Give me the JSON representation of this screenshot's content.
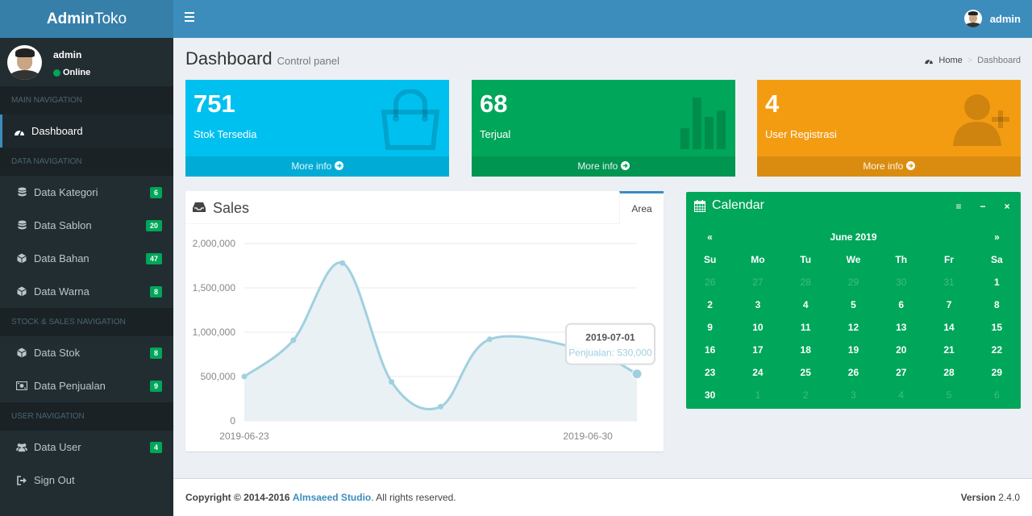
{
  "header": {
    "logo_bold": "Admin",
    "logo_rest": "Toko",
    "user_name": "admin"
  },
  "sidebar": {
    "user_name": "admin",
    "user_status": "Online",
    "sections": [
      {
        "header": "MAIN NAVIGATION"
      },
      {
        "header": "DATA NAVIGATION"
      },
      {
        "header": "STOCK & SALES NAVIGATION"
      },
      {
        "header": "USER NAVIGATION"
      }
    ],
    "items": [
      {
        "label": "Dashboard",
        "icon": "dashboard-icon"
      },
      {
        "label": "Data Kategori",
        "icon": "database-icon",
        "badge": "6"
      },
      {
        "label": "Data Sablon",
        "icon": "database-icon",
        "badge": "20"
      },
      {
        "label": "Data Bahan",
        "icon": "cube-icon",
        "badge": "47"
      },
      {
        "label": "Data Warna",
        "icon": "cube-icon",
        "badge": "8"
      },
      {
        "label": "Data Stok",
        "icon": "cube-icon",
        "badge": "8"
      },
      {
        "label": "Data Penjualan",
        "icon": "money-icon",
        "badge": "9"
      },
      {
        "label": "Data User",
        "icon": "users-icon",
        "badge": "4"
      },
      {
        "label": "Sign Out",
        "icon": "sign-out-icon"
      }
    ]
  },
  "content_header": {
    "title": "Dashboard",
    "subtitle": "Control panel",
    "breadcrumb_home": "Home",
    "breadcrumb_current": "Dashboard"
  },
  "stat_boxes": [
    {
      "value": "751",
      "label": "Stok Tersedia",
      "more": "More info",
      "color": "#00c0ef",
      "icon": "shopping-bag-icon"
    },
    {
      "value": "68",
      "label": "Terjual",
      "more": "More info",
      "color": "#00a65a",
      "icon": "bar-chart-icon"
    },
    {
      "value": "4",
      "label": "User Registrasi",
      "more": "More info",
      "color": "#f39c12",
      "icon": "user-plus-icon"
    }
  ],
  "sales": {
    "title": "Sales",
    "tab": "Area",
    "tooltip_date": "2019-07-01",
    "tooltip_text": "Penjualan: 530,000"
  },
  "chart_data": {
    "type": "area",
    "x_tick_labels": [
      "2019-06-23",
      "2019-06-30"
    ],
    "y_ticks": [
      "2,000,000",
      "1,500,000",
      "1,000,000",
      "500,000",
      "0"
    ],
    "ylim": [
      0,
      2000000
    ],
    "series": [
      {
        "name": "Penjualan",
        "x": [
          "2019-06-23",
          "2019-06-24",
          "2019-06-25",
          "2019-06-26",
          "2019-06-27",
          "2019-06-28",
          "2019-06-30",
          "2019-07-01"
        ],
        "values": [
          500000,
          910000,
          1780000,
          440000,
          160000,
          920000,
          790000,
          530000
        ]
      }
    ]
  },
  "calendar": {
    "title": "Calendar",
    "month": "June 2019",
    "prev": "«",
    "next": "»",
    "tools": [
      "≡",
      "−",
      "×"
    ],
    "weekdays": [
      "Su",
      "Mo",
      "Tu",
      "We",
      "Th",
      "Fr",
      "Sa"
    ],
    "weeks": [
      [
        {
          "d": "26",
          "m": true
        },
        {
          "d": "27",
          "m": true
        },
        {
          "d": "28",
          "m": true
        },
        {
          "d": "29",
          "m": true
        },
        {
          "d": "30",
          "m": true
        },
        {
          "d": "31",
          "m": true
        },
        {
          "d": "1"
        }
      ],
      [
        {
          "d": "2"
        },
        {
          "d": "3"
        },
        {
          "d": "4"
        },
        {
          "d": "5"
        },
        {
          "d": "6"
        },
        {
          "d": "7"
        },
        {
          "d": "8"
        }
      ],
      [
        {
          "d": "9"
        },
        {
          "d": "10"
        },
        {
          "d": "11"
        },
        {
          "d": "12"
        },
        {
          "d": "13"
        },
        {
          "d": "14"
        },
        {
          "d": "15"
        }
      ],
      [
        {
          "d": "16"
        },
        {
          "d": "17"
        },
        {
          "d": "18"
        },
        {
          "d": "19"
        },
        {
          "d": "20"
        },
        {
          "d": "21"
        },
        {
          "d": "22"
        }
      ],
      [
        {
          "d": "23"
        },
        {
          "d": "24"
        },
        {
          "d": "25"
        },
        {
          "d": "26"
        },
        {
          "d": "27"
        },
        {
          "d": "28"
        },
        {
          "d": "29"
        }
      ],
      [
        {
          "d": "30"
        },
        {
          "d": "1",
          "m": true
        },
        {
          "d": "2",
          "m": true
        },
        {
          "d": "3",
          "m": true
        },
        {
          "d": "4",
          "m": true
        },
        {
          "d": "5",
          "m": true
        },
        {
          "d": "6",
          "m": true
        }
      ]
    ]
  },
  "footer": {
    "copyright": "Copyright © 2014-2016",
    "company": "Almsaeed Studio",
    "rights": ". All rights reserved.",
    "version_label": "Version",
    "version": "2.4.0"
  }
}
